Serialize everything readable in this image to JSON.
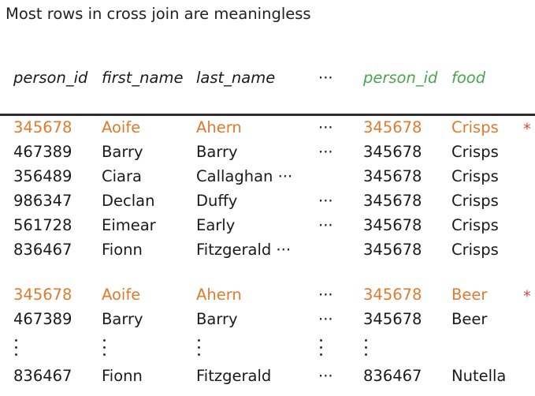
{
  "title": "Most rows in cross join are meaningless",
  "headers": {
    "person_id": "person_id",
    "first_name": "first_name",
    "last_name": "last_name",
    "dots": "···",
    "person_id_2": "person_id",
    "food": "food"
  },
  "rows": [
    {
      "person_id": "345678",
      "first_name": "Aoife",
      "last_name": "Ahern",
      "dots": "···",
      "person_id_2": "345678",
      "food": "Crisps",
      "star": "*"
    },
    {
      "person_id": "467389",
      "first_name": "Barry",
      "last_name": "Barry",
      "dots": "···",
      "person_id_2": "345678",
      "food": "Crisps"
    },
    {
      "person_id": "356489",
      "first_name": "Ciara",
      "last_name": "Callaghan ···",
      "person_id_2": "345678",
      "food": "Crisps"
    },
    {
      "person_id": "986347",
      "first_name": "Declan",
      "last_name": "Duffy",
      "dots": "···",
      "person_id_2": "345678",
      "food": "Crisps"
    },
    {
      "person_id": "561728",
      "first_name": "Eimear",
      "last_name": "Early",
      "dots": "···",
      "person_id_2": "345678",
      "food": "Crisps"
    },
    {
      "person_id": "836467",
      "first_name": "Fionn",
      "last_name": "Fitzgerald ···",
      "person_id_2": "345678",
      "food": "Crisps"
    },
    {
      "person_id": "345678",
      "first_name": "Aoife",
      "last_name": "Ahern",
      "dots": "···",
      "person_id_2": "345678",
      "food": "Beer",
      "star": "*"
    },
    {
      "person_id": "467389",
      "first_name": "Barry",
      "last_name": "Barry",
      "dots": "···",
      "person_id_2": "345678",
      "food": "Beer"
    },
    {
      "person_id": "836467",
      "first_name": "Fionn",
      "last_name": "Fitzgerald",
      "dots": "···",
      "person_id_2": "836467",
      "food": "Nutella"
    }
  ]
}
